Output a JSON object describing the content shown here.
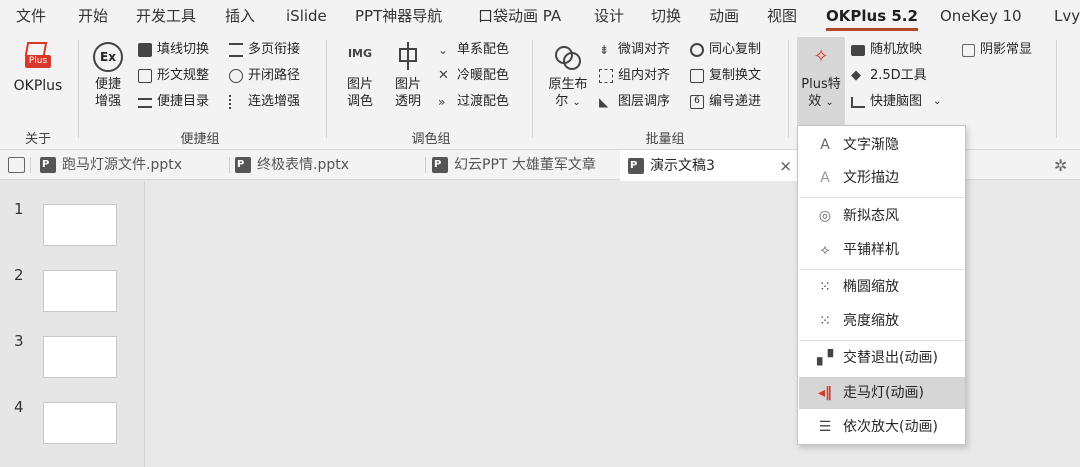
{
  "menu": {
    "items": [
      "文件",
      "开始",
      "开发工具",
      "插入",
      "iSlide",
      "PPT神器导航",
      "口袋动画 PA",
      "设计",
      "切换",
      "动画",
      "视图",
      "OKPlus 5.2",
      "OneKey 10",
      "Lvyh"
    ],
    "active": "OKPlus 5.2"
  },
  "ribbon": {
    "okplus": {
      "icon_text": "Plus",
      "label": "OKPlus",
      "group": "关于"
    },
    "convenient": {
      "big_label_1": "便捷",
      "big_label_2": "增强",
      "items": [
        "填线切换",
        "多页衔接",
        "形文规整",
        "开闭路径",
        "便捷目录",
        "连选增强"
      ],
      "group": "便捷组"
    },
    "color": {
      "img_icon": "IMG",
      "pic_color_1": "图片",
      "pic_color_2": "调色",
      "pic_alpha_1": "图片",
      "pic_alpha_2": "透明",
      "items": [
        "单系配色",
        "冷暖配色",
        "过渡配色"
      ],
      "group": "调色组"
    },
    "batch": {
      "boole_1": "原生布",
      "boole_2": "尔",
      "items": [
        "微调对齐",
        "同心复制",
        "组内对齐",
        "复制换文",
        "图层调序",
        "编号递进"
      ],
      "group": "批量组"
    },
    "plus": {
      "big_1": "Plus特",
      "big_2": "效",
      "items": [
        "随机放映",
        "阴影常显",
        "2.5D工具",
        "快捷脑图"
      ]
    }
  },
  "tabs": [
    {
      "label": "跑马灯源文件.pptx",
      "active": false
    },
    {
      "label": "终极表情.pptx",
      "active": false
    },
    {
      "label": "幻云PPT 大雄董军文章",
      "active": false
    },
    {
      "label": "演示文稿3",
      "active": true
    }
  ],
  "tab_close": "×",
  "slides": [
    "1",
    "2",
    "3",
    "4"
  ],
  "dropdown": {
    "items": [
      "文字渐隐",
      "文形描边",
      "新拟态风",
      "平铺样机",
      "椭圆缩放",
      "亮度缩放",
      "交替退出(动画)",
      "走马灯(动画)",
      "依次放大(动画)"
    ],
    "highlighted": "走马灯(动画)"
  },
  "colors": {
    "accent": "#b7472a",
    "plus_red": "#d9372b"
  }
}
